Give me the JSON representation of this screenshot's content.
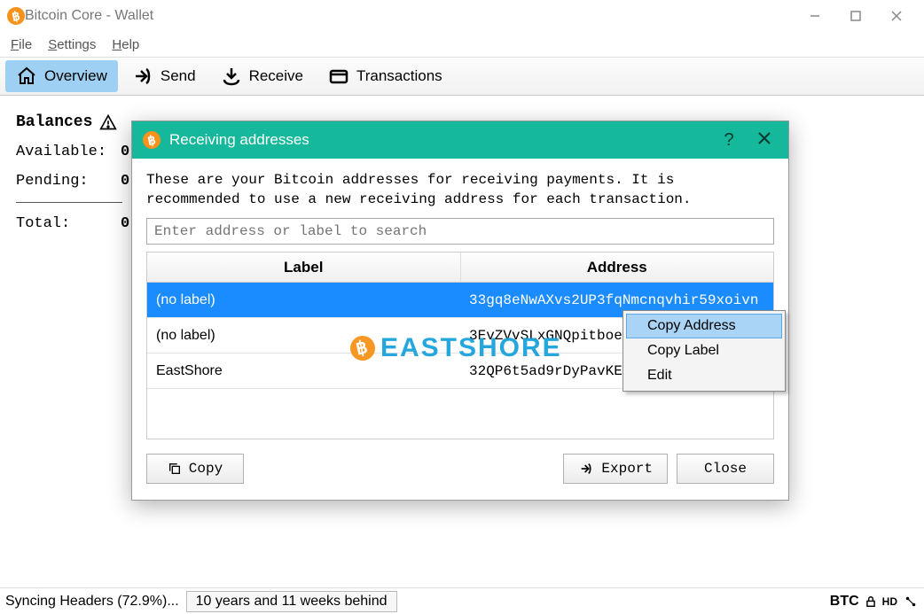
{
  "window": {
    "title": "Bitcoin Core - Wallet"
  },
  "menubar": {
    "file": "File",
    "settings": "Settings",
    "help": "Help"
  },
  "tabs": {
    "overview": "Overview",
    "send": "Send",
    "receive": "Receive",
    "transactions": "Transactions"
  },
  "balances": {
    "title": "Balances",
    "rows": [
      {
        "label": "Available:",
        "value": "0"
      },
      {
        "label": "Pending:",
        "value": "0"
      },
      {
        "label": "Total:",
        "value": "0"
      }
    ]
  },
  "dialog": {
    "title": "Receiving addresses",
    "help_icon": "?",
    "description": "These are your Bitcoin addresses for receiving payments. It is recommended to use a new receiving address for each transaction.",
    "search_placeholder": "Enter address or label to search",
    "columns": {
      "label": "Label",
      "address": "Address"
    },
    "rows": [
      {
        "label": "(no label)",
        "address": "33gq8eNwAXvs2UP3fqNmcnqvhir59xoivn"
      },
      {
        "label": "(no label)",
        "address": "3EvZVvSLxGNQpitboe"
      },
      {
        "label": "EastShore",
        "address": "32QP6t5ad9rDyPavKE"
      }
    ],
    "buttons": {
      "copy": "Copy",
      "export": "Export",
      "close": "Close"
    }
  },
  "context_menu": {
    "items": [
      {
        "label": "Copy Address"
      },
      {
        "label": "Copy Label"
      },
      {
        "label": "Edit"
      }
    ]
  },
  "statusbar": {
    "sync": "Syncing Headers (72.9%)...",
    "behind": "10 years and 11 weeks behind",
    "unit": "BTC",
    "hd": "HD"
  },
  "watermark": "EASTSHORE"
}
